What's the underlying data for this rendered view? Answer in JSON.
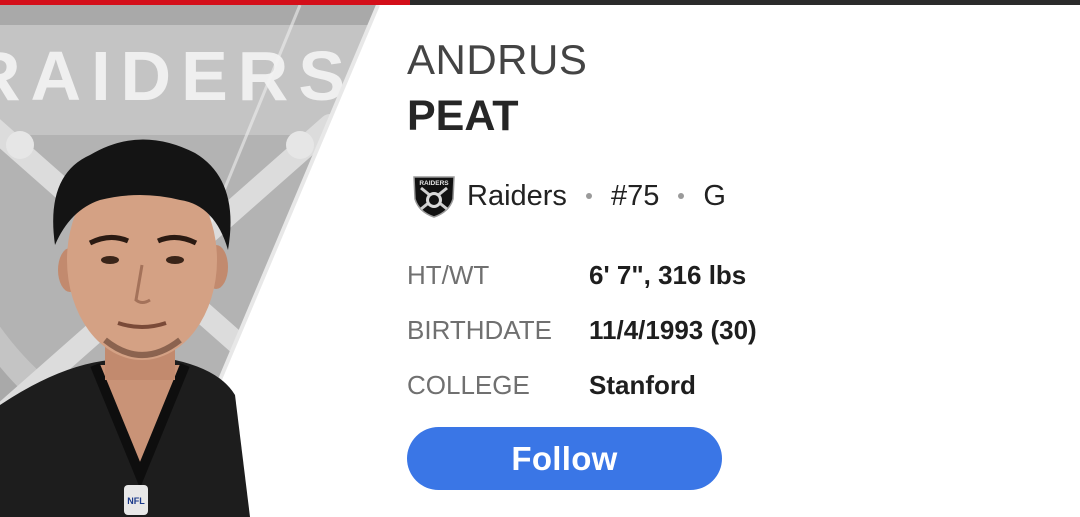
{
  "header": {
    "accent_color": "#d40f1a",
    "bar_color": "#2b2b2b"
  },
  "hero": {
    "watermark_text": "RAIDERS",
    "jersey_badge_text": "NFL"
  },
  "player": {
    "first_name": "ANDRUS",
    "last_name": "PEAT"
  },
  "team": {
    "name": "Raiders",
    "logo_icon": "raiders-shield-icon",
    "logo_text": "RAIDERS",
    "number": "#75",
    "position": "G"
  },
  "stats": [
    {
      "label": "HT/WT",
      "value": "6' 7\", 316 lbs"
    },
    {
      "label": "BIRTHDATE",
      "value": "11/4/1993 (30)"
    },
    {
      "label": "COLLEGE",
      "value": "Stanford"
    }
  ],
  "actions": {
    "follow_label": "Follow",
    "follow_color": "#3a76e6"
  }
}
